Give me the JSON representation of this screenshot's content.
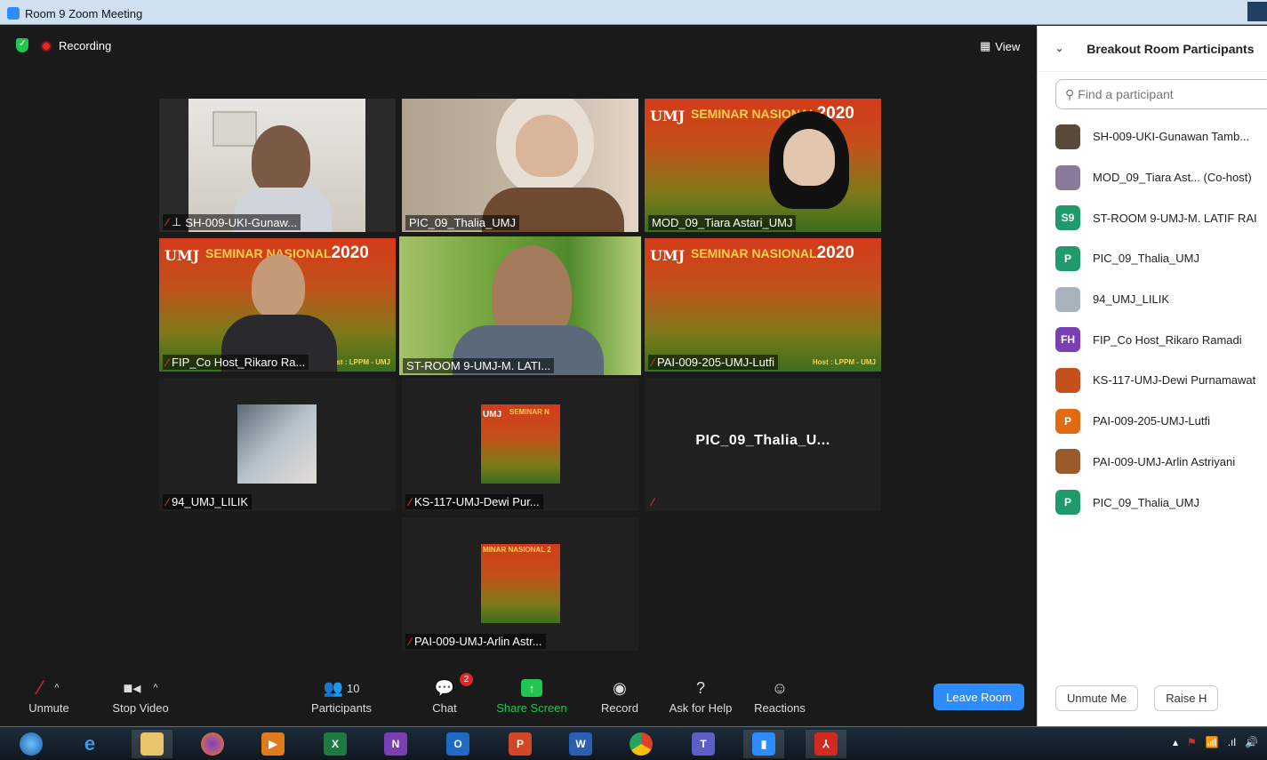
{
  "window": {
    "title": "Room 9   Zoom Meeting"
  },
  "meeting": {
    "recording_label": "Recording",
    "view_label": "View",
    "tiles": [
      {
        "name": "SH-009-UKI-Gunaw...",
        "muted": true,
        "pinned": true
      },
      {
        "name": "PIC_09_Thalia_UMJ",
        "muted": false
      },
      {
        "name": "MOD_09_Tiara Astari_UMJ",
        "muted": false
      },
      {
        "name": "FIP_Co Host_Rikaro Ra...",
        "muted": true
      },
      {
        "name": "ST-ROOM 9-UMJ-M. LATI...",
        "muted": false,
        "active": true
      },
      {
        "name": "PAI-009-205-UMJ-Lutfi",
        "muted": true
      },
      {
        "name": "94_UMJ_LILIK",
        "muted": true
      },
      {
        "name": "KS-117-UMJ-Dewi Pur...",
        "muted": true
      },
      {
        "name": "PIC_09_Thalia_U...",
        "muted": true
      },
      {
        "name": "PAI-009-UMJ-Arlin Astr...",
        "muted": true
      }
    ],
    "banner": {
      "umj": "UMJ",
      "title": "SEMINAR NASIONAL",
      "year": "2020",
      "host": "Host : LPPM - UMJ",
      "host_short": "st : LPPM - UMJ",
      "thumb_title": "SEMINAR N",
      "thumb_title2": "MINAR NASIONAL 2"
    }
  },
  "controls": {
    "unmute": "Unmute",
    "stop_video": "Stop Video",
    "participants": "Participants",
    "participants_count": "10",
    "chat": "Chat",
    "chat_badge": "2",
    "share_screen": "Share Screen",
    "record": "Record",
    "ask_for_help": "Ask for Help",
    "reactions": "Reactions",
    "leave_room": "Leave Room"
  },
  "panel": {
    "title": "Breakout Room Participants",
    "search_placeholder": "Find a participant",
    "participants": [
      {
        "name": "SH-009-UKI-Gunawan Tamb...",
        "initials": "",
        "color": "#5a4a3a"
      },
      {
        "name": "MOD_09_Tiara Ast...   (Co-host)",
        "initials": "",
        "color": "#8a7a9a"
      },
      {
        "name": "ST-ROOM 9-UMJ-M. LATIF RAI",
        "initials": "S9",
        "color": "#1f9b6b"
      },
      {
        "name": "PIC_09_Thalia_UMJ",
        "initials": "P",
        "color": "#1f9b6b"
      },
      {
        "name": "94_UMJ_LILIK",
        "initials": "",
        "color": "#a9b3bd"
      },
      {
        "name": "FIP_Co Host_Rikaro Ramadi",
        "initials": "FH",
        "color": "#7b3fb5"
      },
      {
        "name": "KS-117-UMJ-Dewi Purnamawat",
        "initials": "",
        "color": "#c4501b"
      },
      {
        "name": "PAI-009-205-UMJ-Lutfi",
        "initials": "P",
        "color": "#e06b12"
      },
      {
        "name": "PAI-009-UMJ-Arlin Astriyani",
        "initials": "",
        "color": "#9b5a2a"
      },
      {
        "name": "PIC_09_Thalia_UMJ",
        "initials": "P",
        "color": "#1f9b6b"
      }
    ],
    "unmute_me": "Unmute Me",
    "raise_hand": "Raise H"
  },
  "taskbar": {
    "apps": [
      "start-orb",
      "internet-explorer",
      "file-explorer",
      "firefox",
      "media-player",
      "excel",
      "onenote",
      "outlook",
      "powerpoint",
      "word",
      "chrome",
      "teams",
      "zoom",
      "acrobat"
    ]
  }
}
